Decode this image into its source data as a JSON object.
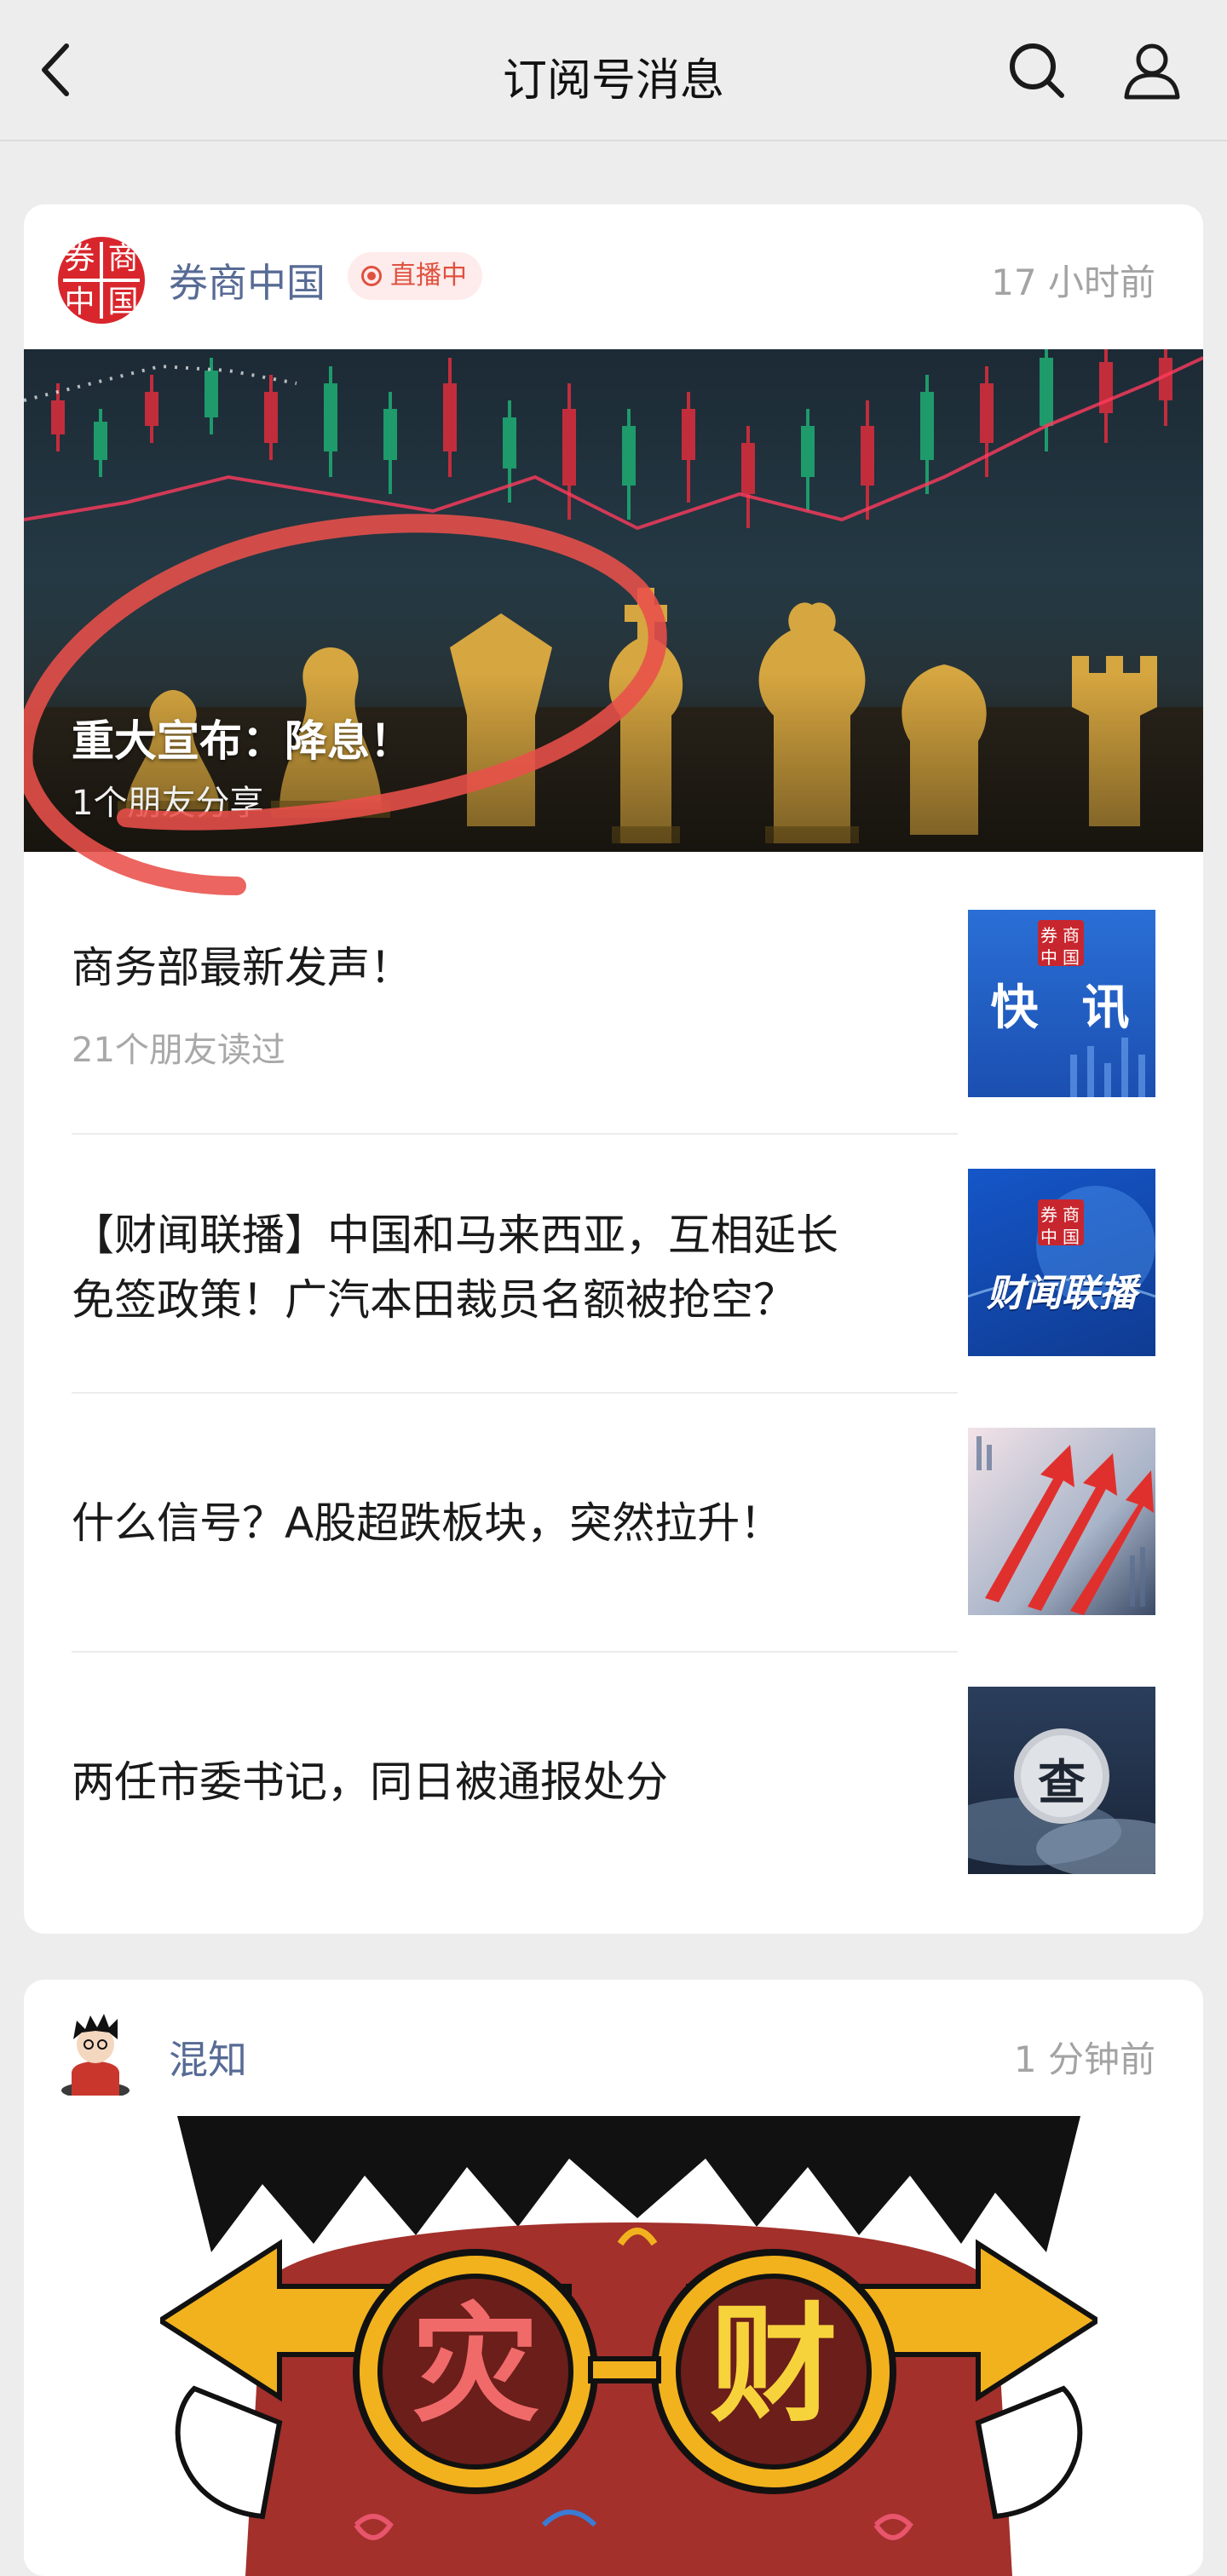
{
  "header": {
    "title": "订阅号消息"
  },
  "card1": {
    "account_name": "券商中国",
    "logo_chars": [
      "券",
      "商",
      "中",
      "国"
    ],
    "live_badge": "直播中",
    "time": "17 小时前",
    "hero": {
      "title": "重大宣布：降息！",
      "subtitle": "1个朋友分享"
    },
    "items": [
      {
        "title": "商务部最新发声！",
        "meta": "21个朋友读过",
        "thumb_text": "快  讯",
        "thumb_logo": [
          "券",
          "商",
          "中",
          "国"
        ]
      },
      {
        "title_line1": "【财闻联播】中国和马来西亚，互相延长",
        "title_line2": "免签政策！广汽本田裁员名额被抢空？",
        "thumb_text": "财闻联播",
        "thumb_logo": [
          "券",
          "商",
          "中",
          "国"
        ]
      },
      {
        "title": "什么信号？A股超跌板块，突然拉升！"
      },
      {
        "title": "两任市委书记，同日被通报处分",
        "thumb_text": "查"
      }
    ]
  },
  "card2": {
    "account_name": "混知",
    "time": "1 分钟前",
    "cartoon_chars": [
      "灾",
      "财"
    ]
  },
  "colors": {
    "link_blue": "#576b95",
    "live_red": "#e0513f",
    "logo_red": "#d8262c",
    "annotation_red": "#e9504a"
  }
}
